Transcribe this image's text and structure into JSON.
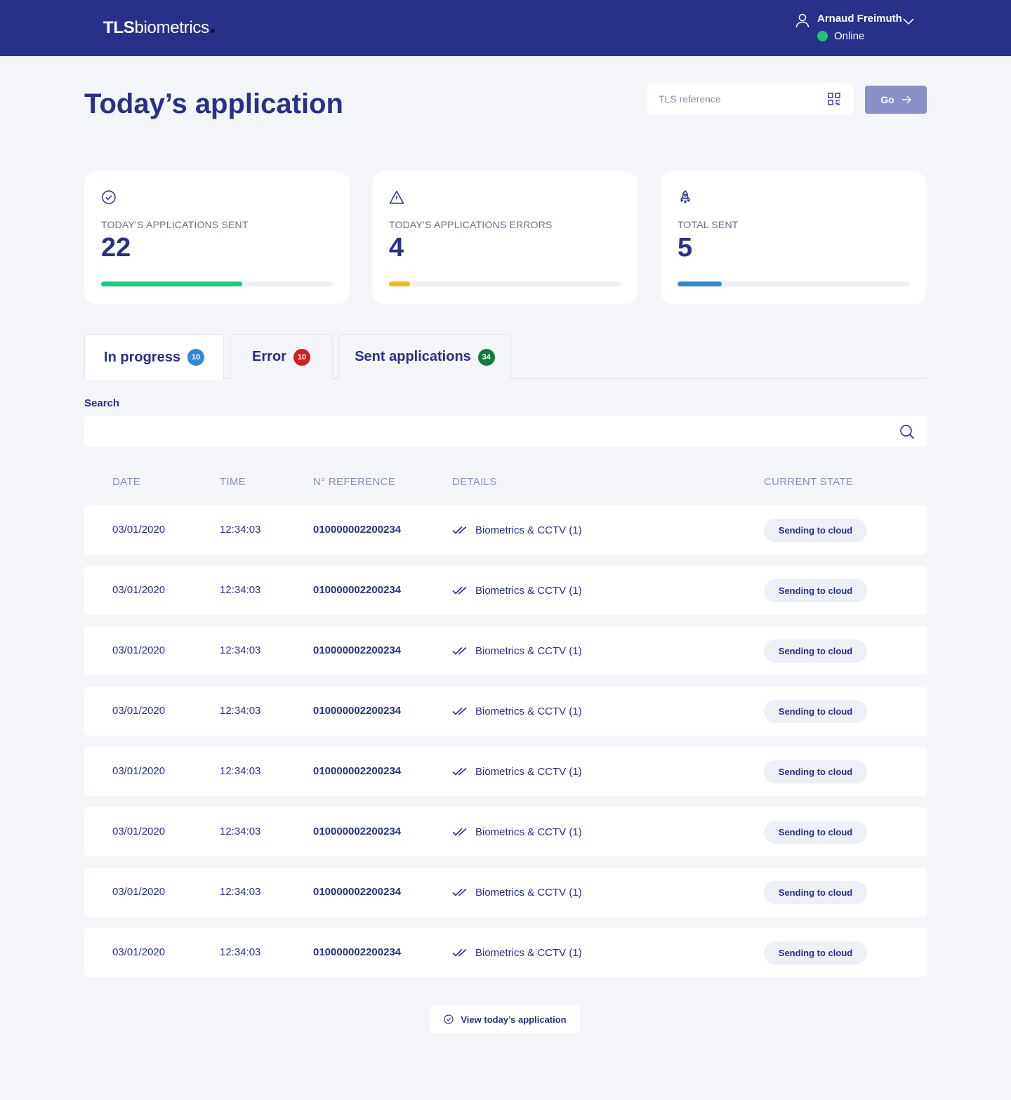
{
  "header": {
    "brand_bold": "TLS",
    "brand_rest": "biometrics",
    "user_name": "Arnaud Freimuth",
    "status": "Online"
  },
  "page": {
    "title": "Today’s application",
    "reference_placeholder": "TLS reference",
    "go_label": "Go"
  },
  "stats": [
    {
      "label": "TODAY’S APPLICATIONS SENT",
      "value": "22",
      "progress": 0.61,
      "color": "#14cc80",
      "icon": "check-circle-icon"
    },
    {
      "label": "TODAY’S APPLICATIONS ERRORS",
      "value": "4",
      "progress": 0.09,
      "color": "#f7b81b",
      "icon": "warning-icon"
    },
    {
      "label": "TOTAL SENT",
      "value": "5",
      "progress": 0.19,
      "color": "#2f8ad2",
      "icon": "rocket-icon"
    }
  ],
  "tabs": [
    {
      "label": "In progress",
      "count": "10",
      "color": "#2f8ad2"
    },
    {
      "label": "Error",
      "count": "10",
      "color": "#d01f1f"
    },
    {
      "label": "Sent applications",
      "count": "34",
      "color": "#157a3a"
    }
  ],
  "search": {
    "label": "Search",
    "placeholder": ""
  },
  "table": {
    "columns": [
      "DATE",
      "TIME",
      "N° REFERENCE",
      "DETAILS",
      "CURRENT STATE"
    ],
    "rows": [
      {
        "date": "03/01/2020",
        "time": "12:34:03",
        "reference": "010000002200234",
        "details": "Biometrics & CCTV (1)",
        "state": "Sending to cloud"
      },
      {
        "date": "03/01/2020",
        "time": "12:34:03",
        "reference": "010000002200234",
        "details": "Biometrics & CCTV (1)",
        "state": "Sending to cloud"
      },
      {
        "date": "03/01/2020",
        "time": "12:34:03",
        "reference": "010000002200234",
        "details": "Biometrics & CCTV (1)",
        "state": "Sending to cloud"
      },
      {
        "date": "03/01/2020",
        "time": "12:34:03",
        "reference": "010000002200234",
        "details": "Biometrics & CCTV (1)",
        "state": "Sending to cloud"
      },
      {
        "date": "03/01/2020",
        "time": "12:34:03",
        "reference": "010000002200234",
        "details": "Biometrics & CCTV (1)",
        "state": "Sending to cloud"
      },
      {
        "date": "03/01/2020",
        "time": "12:34:03",
        "reference": "010000002200234",
        "details": "Biometrics & CCTV (1)",
        "state": "Sending to cloud"
      },
      {
        "date": "03/01/2020",
        "time": "12:34:03",
        "reference": "010000002200234",
        "details": "Biometrics & CCTV (1)",
        "state": "Sending to cloud"
      },
      {
        "date": "03/01/2020",
        "time": "12:34:03",
        "reference": "010000002200234",
        "details": "Biometrics & CCTV (1)",
        "state": "Sending to cloud"
      }
    ]
  },
  "footer": {
    "view_label": "View today’s application"
  }
}
